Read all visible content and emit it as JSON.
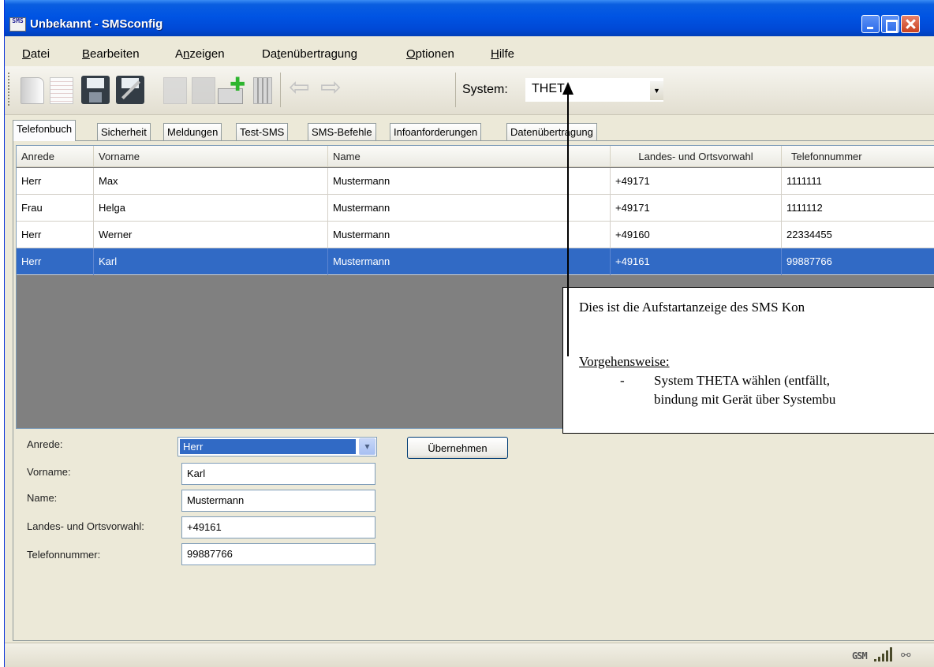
{
  "window": {
    "title": "Unbekannt - SMSconfig",
    "icon_text": "SMS"
  },
  "menu": {
    "items": [
      {
        "label": "Datei",
        "accel": "D"
      },
      {
        "label": "Bearbeiten",
        "accel": "B"
      },
      {
        "label": "Anzeigen",
        "accel": "n"
      },
      {
        "label": "Datenübertragung",
        "accel": "t"
      },
      {
        "label": "Optionen",
        "accel": "O"
      },
      {
        "label": "Hilfe",
        "accel": "H"
      }
    ]
  },
  "toolbar": {
    "icons": [
      "new-document-icon",
      "page-icon",
      "save-icon",
      "save-as-icon",
      "copy-icon",
      "paste-icon",
      "add-entry-icon",
      "delete-icon",
      "back-arrow-icon",
      "forward-arrow-icon"
    ],
    "system_label": "System:",
    "system_value": "THETA",
    "back_glyph": "⇦",
    "forward_glyph": "⇨",
    "dropdown_glyph": "▼"
  },
  "tabs": [
    {
      "label": "Telefonbuch",
      "active": true
    },
    {
      "label": "Sicherheit"
    },
    {
      "label": "Meldungen"
    },
    {
      "label": "Test-SMS"
    },
    {
      "label": "SMS-Befehle"
    },
    {
      "label": "Infoanforderungen"
    },
    {
      "label": "Datenübertragung"
    }
  ],
  "grid": {
    "columns": [
      "Anrede",
      "Vorname",
      "Name",
      "Landes- und Ortsvorwahl",
      "Telefonnummer"
    ],
    "rows": [
      [
        "Herr",
        "Max",
        "Mustermann",
        "+49171",
        "1111111"
      ],
      [
        "Frau",
        "Helga",
        "Mustermann",
        "+49171",
        "1111112"
      ],
      [
        "Herr",
        "Werner",
        "Mustermann",
        "+49160",
        "22334455"
      ],
      [
        "Herr",
        "Karl",
        "Mustermann",
        "+49161",
        "99887766"
      ]
    ],
    "selected_row": 3
  },
  "form": {
    "anrede_label": "Anrede:",
    "anrede_value": "Herr",
    "vorname_label": "Vorname:",
    "vorname_value": "Karl",
    "name_label": "Name:",
    "name_value": "Mustermann",
    "vorwahl_label": "Landes- und Ortsvorwahl:",
    "vorwahl_value": "+49161",
    "telefon_label": "Telefonnummer:",
    "telefon_value": "99887766",
    "apply_button": "Übernehmen",
    "combo_glyph": "▾"
  },
  "callout": {
    "line1": "Dies ist die Aufstartanzeige des SMS Kon",
    "heading": "Vorgehensweise:",
    "dash": "-",
    "bullet_line1": "System THETA wählen (entfällt,",
    "bullet_line2": "bindung mit Gerät über Systembu"
  },
  "statusbar": {
    "gsm_label": "GSM",
    "signal_level": 5,
    "link_glyph": "⚯"
  },
  "colors": {
    "titlebar": "#0054e3",
    "selection": "#316ac5",
    "grid_background": "#808080",
    "window_face": "#ece9d8"
  }
}
